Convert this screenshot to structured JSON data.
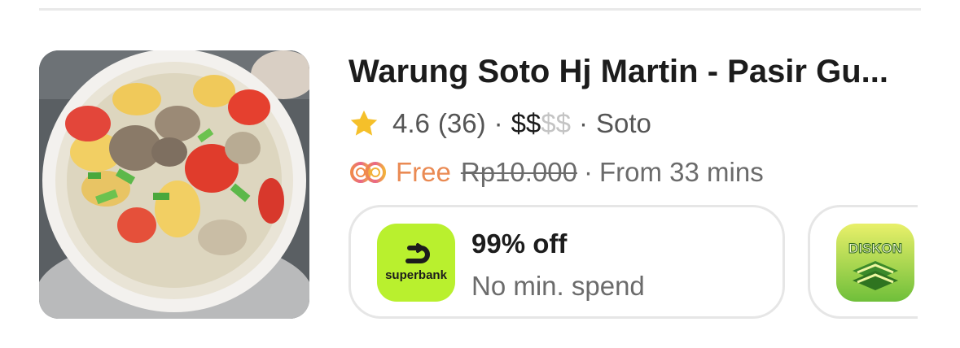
{
  "restaurant": {
    "name": "Warung Soto Hj Martin - Pasir Gu...",
    "rating": "4.6",
    "review_count": "(36)",
    "separator": "·",
    "price_active": "$$",
    "price_inactive": "$$",
    "cuisine": "Soto"
  },
  "delivery": {
    "fee_label": "Free",
    "original_fee": "Rp10.000",
    "eta": "From 33 mins"
  },
  "promos": [
    {
      "logo_text": "superbank",
      "title": "99% off",
      "subtitle": "No min. spend",
      "logo_color": "#b9f02e"
    },
    {
      "logo_text": "DISKON",
      "logo_color": "#8fc63f"
    }
  ],
  "colors": {
    "star": "#f5c02a",
    "free_accent": "#ea8a53",
    "price_inactive": "#c4c4c4"
  },
  "icons": {
    "rating": "star-icon",
    "delivery": "infinity-loop-icon"
  }
}
